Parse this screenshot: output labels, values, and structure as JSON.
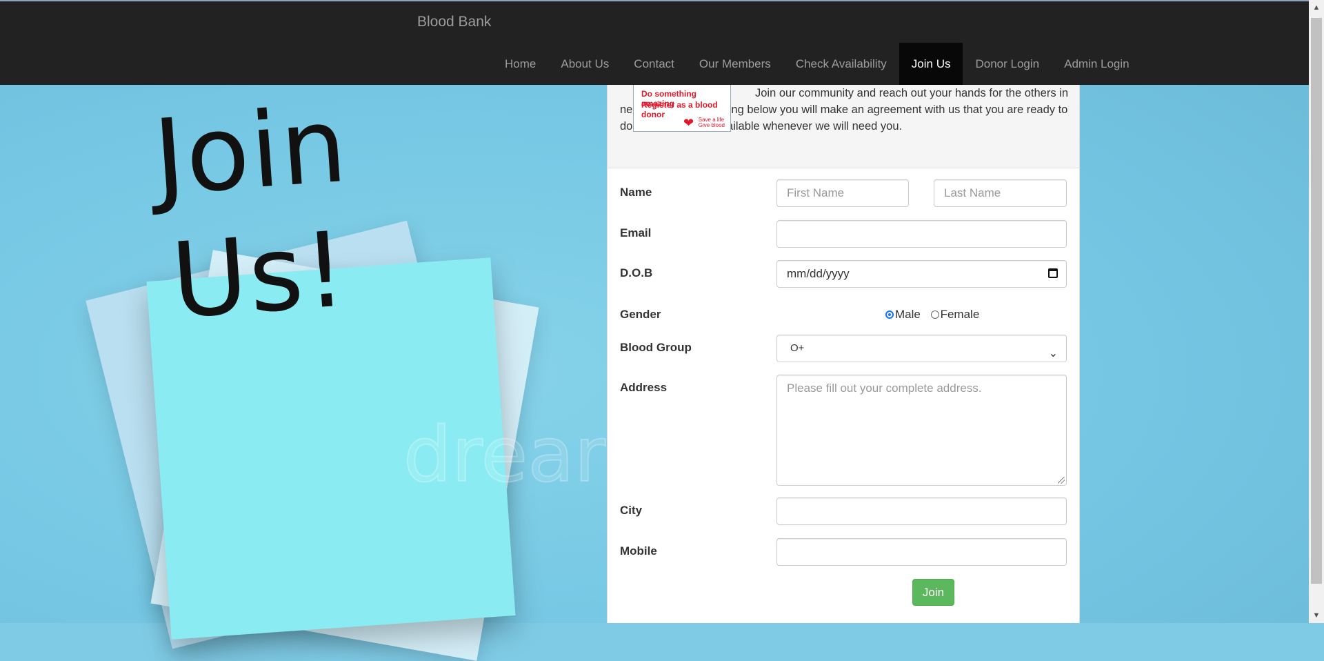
{
  "brand": "Blood Bank",
  "nav": [
    {
      "label": "Home"
    },
    {
      "label": "About Us"
    },
    {
      "label": "Contact"
    },
    {
      "label": "Our Members"
    },
    {
      "label": "Check Availability"
    },
    {
      "label": "Join Us",
      "active": true
    },
    {
      "label": "Donor Login"
    },
    {
      "label": "Admin Login"
    }
  ],
  "hero": {
    "note_line1": "Join",
    "note_line2": "Us!",
    "watermark": "drear"
  },
  "promo": {
    "line1": "Do something amazing",
    "line2": "Register as a blood donor",
    "logo_line1": "Save a life",
    "logo_line2": "Give blood"
  },
  "intro": "Join our community and reach out your hands for the others in need. Just by registering below you will make an agreement with us that you are ready to donate and will be available whenever we will need you.",
  "form": {
    "name_label": "Name",
    "first_name_placeholder": "First Name",
    "last_name_placeholder": "Last Name",
    "email_label": "Email",
    "dob_label": "D.O.B",
    "dob_placeholder": "mm/dd/yyyy",
    "gender_label": "Gender",
    "gender_options": [
      "Male",
      "Female"
    ],
    "gender_selected": "Male",
    "blood_group_label": "Blood Group",
    "blood_group_value": "O+",
    "address_label": "Address",
    "address_placeholder": "Please fill out your complete address.",
    "city_label": "City",
    "mobile_label": "Mobile",
    "submit_label": "Join"
  },
  "colors": {
    "navbar": "#222222",
    "nav_active": "#080808",
    "button": "#5cb85c",
    "background": "#7fcbe6"
  }
}
